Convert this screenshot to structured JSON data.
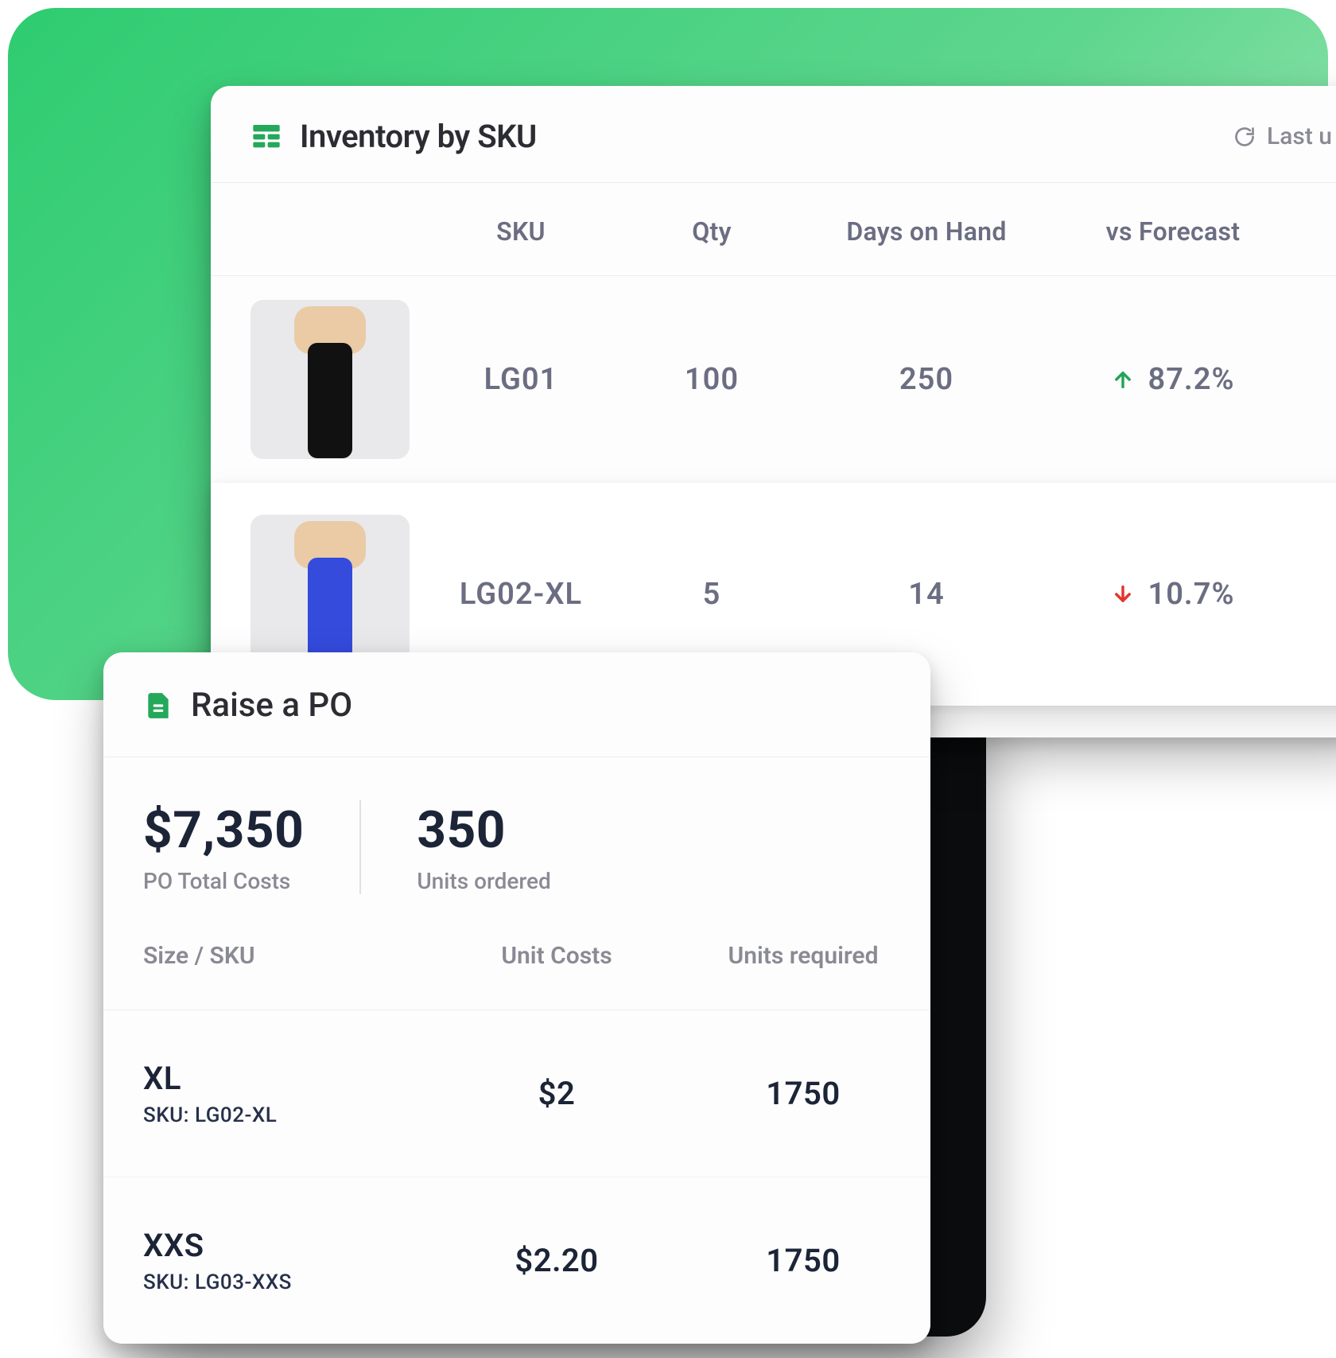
{
  "inventory": {
    "title": "Inventory by SKU",
    "last_updated_label": "Last u",
    "columns": {
      "sku": "SKU",
      "qty": "Qty",
      "days": "Days on Hand",
      "forecast": "vs Forecast"
    },
    "rows": [
      {
        "sku": "LG01",
        "qty": "100",
        "days": "250",
        "forecast_dir": "up",
        "forecast_pct": "87.2%",
        "img_variant": "black"
      },
      {
        "sku": "LG02-XL",
        "qty": "5",
        "days": "14",
        "forecast_dir": "down",
        "forecast_pct": "10.7%",
        "img_variant": "blue",
        "highlight": true
      }
    ]
  },
  "po": {
    "title": "Raise a PO",
    "total_label": "PO Total Costs",
    "total_value": "$7,350",
    "units_label": "Units ordered",
    "units_value": "350",
    "columns": {
      "size": "Size / SKU",
      "unit_cost": "Unit Costs",
      "units_required": "Units required"
    },
    "rows": [
      {
        "size": "XL",
        "sku_label": "SKU: LG02-XL",
        "unit_cost": "$2",
        "units_required": "1750"
      },
      {
        "size": "XXS",
        "sku_label": "SKU: LG03-XXS",
        "unit_cost": "$2.20",
        "units_required": "1750"
      }
    ]
  }
}
